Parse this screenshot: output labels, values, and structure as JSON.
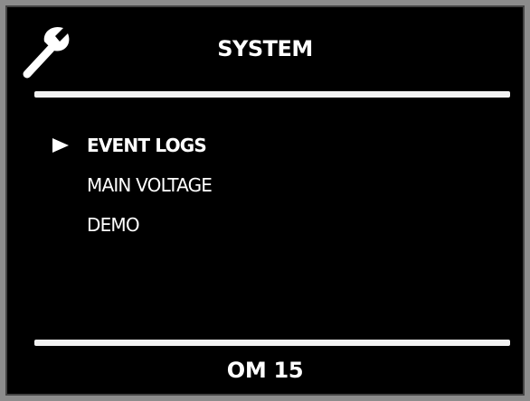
{
  "header": {
    "icon": "wrench-icon",
    "title": "SYSTEM"
  },
  "menu": {
    "selected_index": 0,
    "items": [
      {
        "label": "EVENT LOGS",
        "selected": true
      },
      {
        "label": "MAIN VOLTAGE",
        "selected": false
      },
      {
        "label": "DEMO",
        "selected": false
      }
    ]
  },
  "footer": {
    "label": "OM 15"
  },
  "colors": {
    "screen_background": "#000000",
    "text": "#ffffff",
    "bezel": "#8c8c8c"
  }
}
